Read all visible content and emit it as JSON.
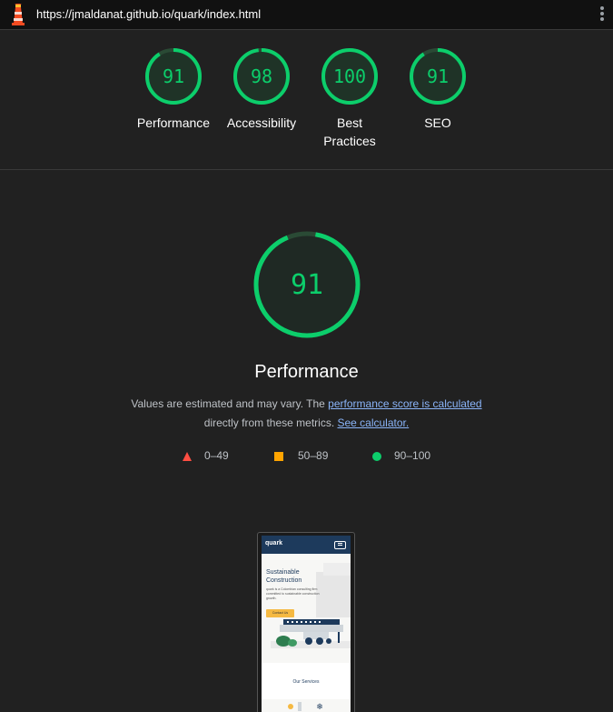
{
  "topbar": {
    "url": "https://jmaldanat.github.io/quark/index.html",
    "logo_icon": "lighthouse-icon",
    "menu_icon": "kebab-menu-icon"
  },
  "summary": [
    {
      "label": "Performance",
      "score": "91",
      "value": 91
    },
    {
      "label": "Accessibility",
      "score": "98",
      "value": 98
    },
    {
      "label": "Best Practices",
      "score": "100",
      "value": 100
    },
    {
      "label": "SEO",
      "score": "91",
      "value": 91
    }
  ],
  "main": {
    "score": "91",
    "value": 91,
    "title": "Performance",
    "desc_prefix": "Values are estimated and may vary. The ",
    "desc_link": "performance score is calculated",
    "desc_middle": "directly from these metrics. ",
    "calc_link": "See calculator."
  },
  "legend": [
    {
      "range": "0–49",
      "shape": "triangle",
      "color": "#ff4e42"
    },
    {
      "range": "50–89",
      "shape": "square",
      "color": "#ffa400"
    },
    {
      "range": "90–100",
      "shape": "circle",
      "color": "#0cce6b"
    }
  ],
  "colors": {
    "pass": "#0cce6b",
    "average": "#ffa400",
    "fail": "#ff4e42",
    "background": "#212121",
    "link": "#8ab4f8"
  },
  "screenshot": {
    "brand": "quark",
    "hero_title": "Sustainable Construction",
    "hero_text": "quark is a Colombian consulting firm committed to sustainable construction growth.",
    "cta": "Contact Us",
    "section": "Our Services"
  }
}
